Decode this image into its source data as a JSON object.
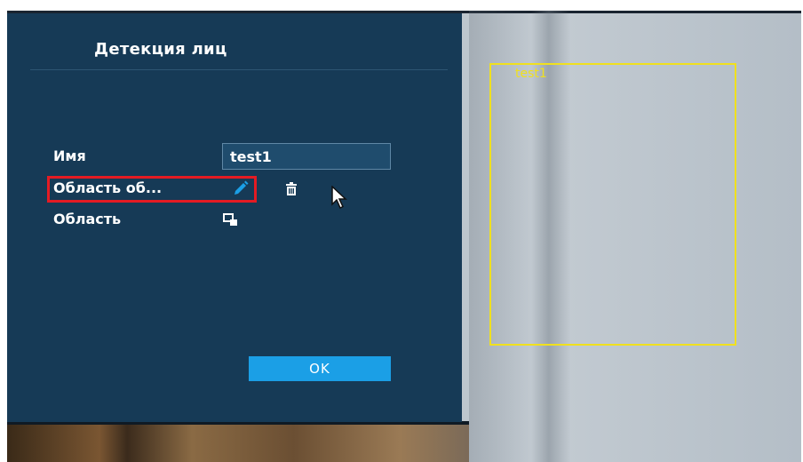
{
  "panel": {
    "title": "Детекция лиц",
    "name_label": "Имя",
    "name_value": "test1",
    "detection_area_label": "Область об...",
    "area_label": "Область",
    "ok_label": "OK",
    "icons": {
      "edit": "pencil-icon",
      "delete": "trash-icon",
      "area": "area-select-icon"
    }
  },
  "preview": {
    "region_label": "test1"
  },
  "colors": {
    "panel_bg": "#163a56",
    "input_bg": "#1f4c6d",
    "accent": "#1b9fe6",
    "highlight": "#e41b23",
    "detection_box": "#f0e01e"
  }
}
